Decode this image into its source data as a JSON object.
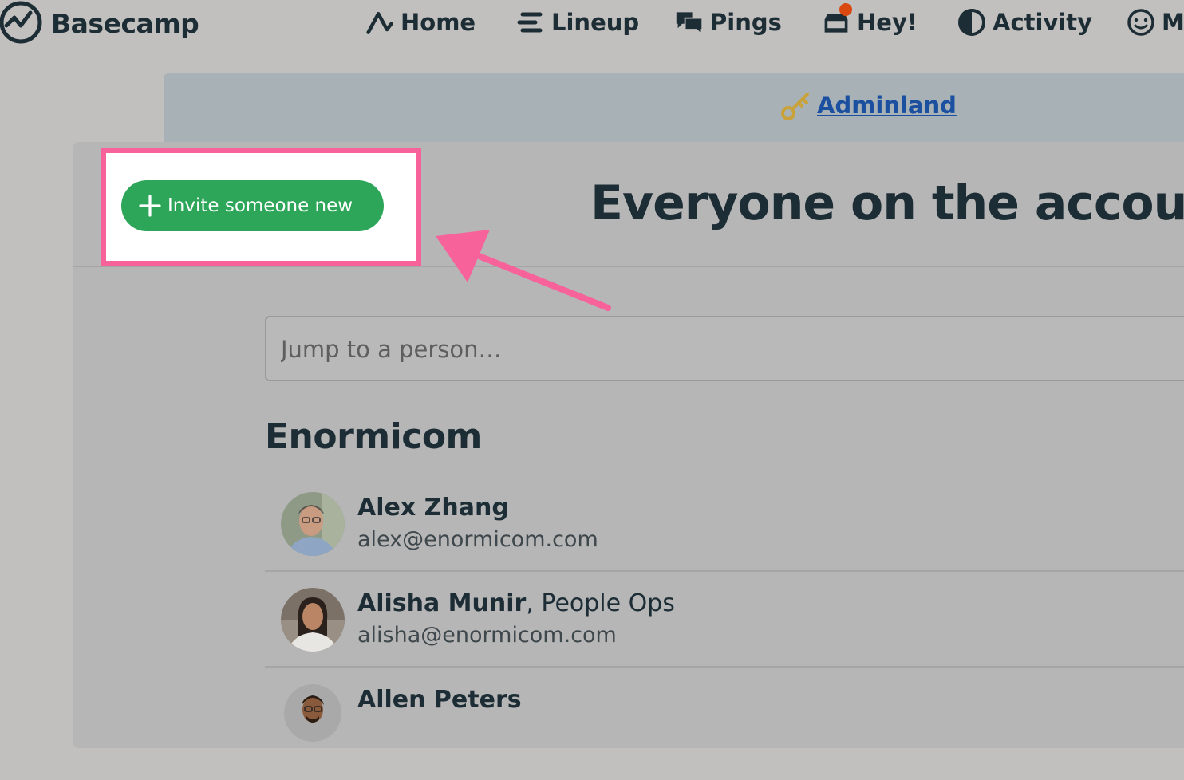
{
  "brand": {
    "name": "Basecamp"
  },
  "nav": {
    "items": [
      {
        "label": "Home",
        "icon": "home-icon"
      },
      {
        "label": "Lineup",
        "icon": "lineup-icon"
      },
      {
        "label": "Pings",
        "icon": "pings-icon"
      },
      {
        "label": "Hey!",
        "icon": "hey-inbox-icon"
      },
      {
        "label": "Activity",
        "icon": "activity-icon"
      },
      {
        "label": "M",
        "icon": "me-smiley-icon"
      }
    ]
  },
  "adminland": {
    "label": "Adminland",
    "icon": "key-icon"
  },
  "page": {
    "title": "Everyone on the account",
    "invite_label": "Invite someone new",
    "search_placeholder": "Jump to a person…"
  },
  "company": {
    "name": "Enormicom",
    "people": [
      {
        "name": "Alex Zhang",
        "role": "",
        "email": "alex@enormicom.com"
      },
      {
        "name": "Alisha Munir",
        "role": ", People Ops",
        "email": "alisha@enormicom.com"
      },
      {
        "name": "Allen Peters",
        "role": "",
        "email": ""
      }
    ]
  },
  "colors": {
    "highlight": "#f8629a",
    "invite_button": "#2ea65a",
    "link": "#1b4fa0",
    "notification_dot": "#d9480f"
  }
}
